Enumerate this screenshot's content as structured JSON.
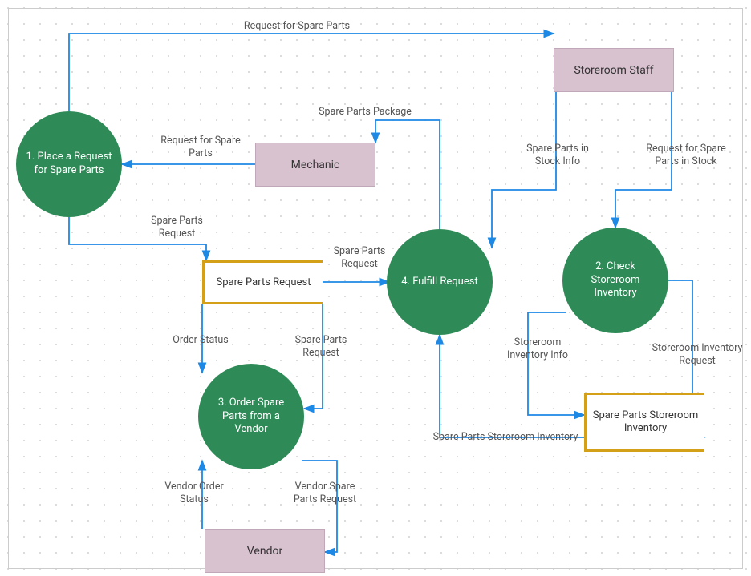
{
  "processes": {
    "p1": "1. Place a Request for Spare Parts",
    "p2": "2. Check Storeroom Inventory",
    "p3": "3. Order Spare Parts from a Vendor",
    "p4": "4. Fulfill Request"
  },
  "entities": {
    "mechanic": "Mechanic",
    "storeroom_staff": "Storeroom Staff",
    "vendor": "Vendor"
  },
  "datastores": {
    "spare_parts_request": "Spare Parts Request",
    "spare_parts_inventory": "Spare Parts Storeroom Inventory"
  },
  "labels": {
    "l1": "Request for Spare Parts",
    "l2": "Request for Spare Parts",
    "l3": "Spare Parts Package",
    "l4": "Spare Parts in Stock Info",
    "l5": "Request for Spare Parts in Stock",
    "l6": "Spare Parts Request",
    "l7": "Spare Parts Request",
    "l8": "Order Status",
    "l9": "Spare Parts Request",
    "l10": "Storeroom Inventory Info",
    "l11": "Storeroom Inventory Request",
    "l12": "Vendor Order Status",
    "l13": "Vendor Spare Parts Request",
    "l14": "Spare Parts Storeroom Inventory"
  }
}
